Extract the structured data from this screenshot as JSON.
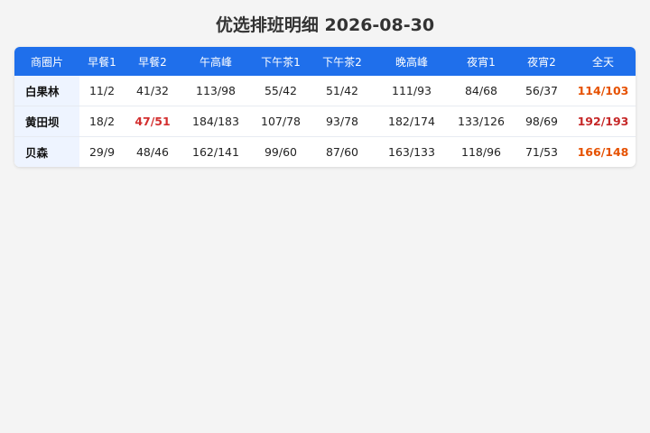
{
  "title": "优选排班明细 2026-08-30",
  "colors": {
    "header_bg": "#1f6feb",
    "row_label_bg": "#eef4ff",
    "alert_red": "#d32f2f",
    "total_orange": "#e65100",
    "total_red": "#c62828"
  },
  "table": {
    "headers": [
      "商圈片",
      "早餐1",
      "早餐2",
      "午高峰",
      "下午茶1",
      "下午茶2",
      "晚高峰",
      "夜宵1",
      "夜宵2",
      "全天"
    ],
    "rows": [
      {
        "name": "白果林",
        "cells": [
          "11/2",
          "41/32",
          "113/98",
          "55/42",
          "51/42",
          "111/93",
          "84/68",
          "56/37"
        ],
        "total": "114/103",
        "total_color": "#e65100",
        "highlight_index": -1
      },
      {
        "name": "黄田坝",
        "cells": [
          "18/2",
          "47/51",
          "184/183",
          "107/78",
          "93/78",
          "182/174",
          "133/126",
          "98/69"
        ],
        "total": "192/193",
        "total_color": "#c62828",
        "highlight_index": 1
      },
      {
        "name": "贝森",
        "cells": [
          "29/9",
          "48/46",
          "162/141",
          "99/60",
          "87/60",
          "163/133",
          "118/96",
          "71/53"
        ],
        "total": "166/148",
        "total_color": "#e65100",
        "highlight_index": -1
      }
    ]
  }
}
